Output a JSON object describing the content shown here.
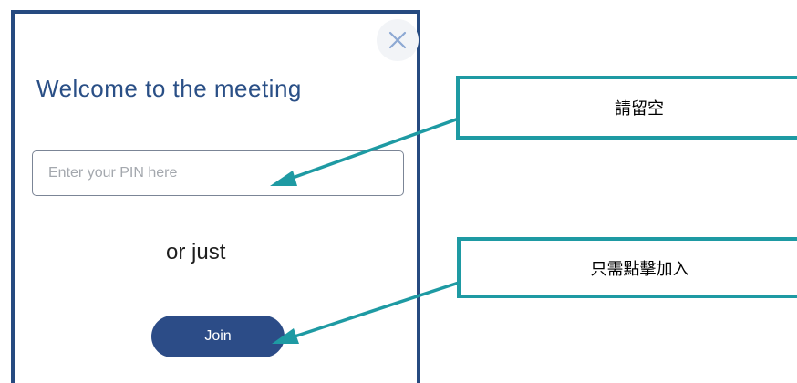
{
  "dialog": {
    "close_icon": "close-icon",
    "title": "Welcome to the meeting",
    "pin_placeholder": "Enter your PIN here",
    "pin_value": "",
    "or_text": "or just",
    "join_label": "Join"
  },
  "annotations": [
    {
      "text": "請留空",
      "target": "pin-input"
    },
    {
      "text": "只需點擊加入",
      "target": "join-button"
    }
  ],
  "colors": {
    "dialog_border": "#264a80",
    "title": "#2a4f86",
    "join_button": "#2c4c87",
    "callout_teal": "#1e9aa3",
    "close_icon": "#8da9d3"
  }
}
